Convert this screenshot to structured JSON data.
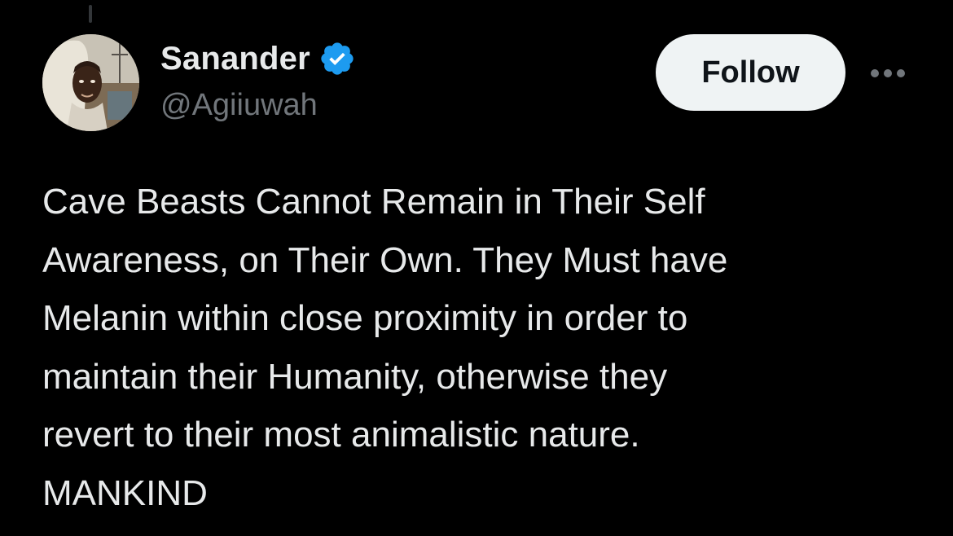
{
  "author": {
    "display_name": "Sanander",
    "handle": "@Agiiuwah",
    "verified": true,
    "verified_color": "#1d9bf0"
  },
  "actions": {
    "follow_label": "Follow",
    "more_icon": "more-horizontal-icon"
  },
  "tweet": {
    "lines": [
      "Cave Beasts Cannot Remain in Their Self",
      "Awareness, on Their Own. They Must have",
      "Melanin within close proximity in order to",
      "maintain their Humanity, otherwise they",
      "revert to their most animalistic nature.",
      "MANKIND"
    ]
  },
  "theme": {
    "background": "#000000",
    "text_primary": "#e7e9ea",
    "text_secondary": "#71767b",
    "button_bg": "#eff3f4",
    "button_text": "#0f1419"
  }
}
